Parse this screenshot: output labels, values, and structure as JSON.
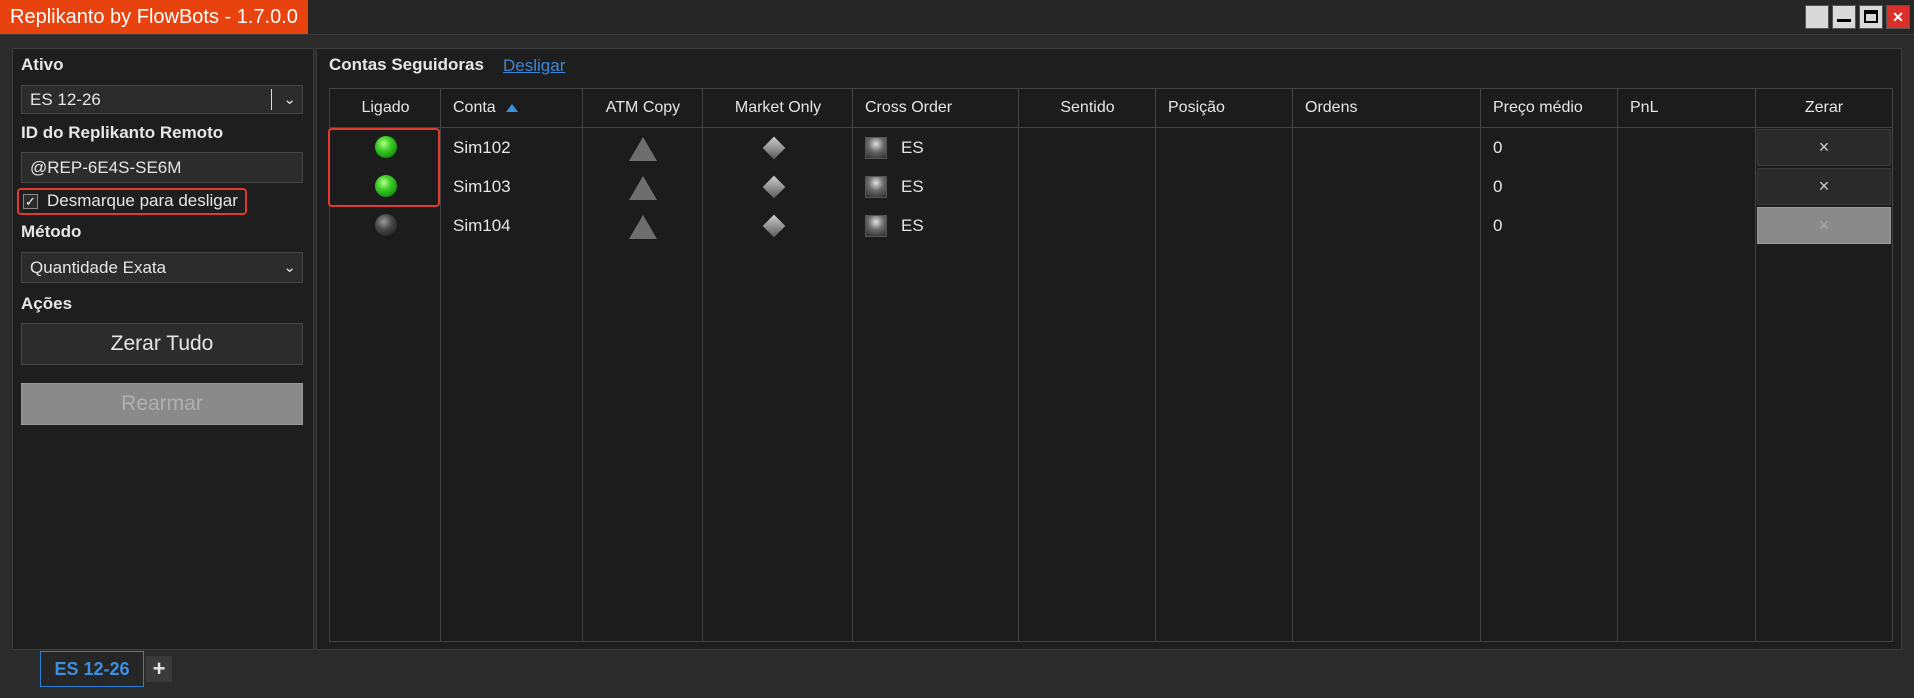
{
  "window": {
    "title": "Replikanto by FlowBots - 1.7.0.0",
    "buttons": [
      "blank",
      "minimize",
      "maximize",
      "close"
    ],
    "accent_color": "#e8430e"
  },
  "left": {
    "ativo_label": "Ativo",
    "ativo_value": "ES 12-26",
    "remote_id_label": "ID do Replikanto Remoto",
    "remote_id_value": "@REP-6E4S-SE6M",
    "checkbox_label": "Desmarque para desligar",
    "checkbox_checked": true,
    "metodo_label": "Método",
    "metodo_value": "Quantidade Exata",
    "acoes_label": "Ações",
    "zerar_tudo_label": "Zerar Tudo",
    "rearmar_label": "Rearmar"
  },
  "right": {
    "section_title": "Contas Seguidoras",
    "desligar_link": "Desligar",
    "columns": [
      "Ligado",
      "Conta",
      "ATM Copy",
      "Market Only",
      "Cross Order",
      "Sentido",
      "Posição",
      "Ordens",
      "Preço médio",
      "PnL",
      "Zerar"
    ],
    "rows": [
      {
        "ligado": "on",
        "conta": "Sim102",
        "atm_icon": "triangle-icon",
        "market_icon": "diamond-icon",
        "cross_order": "ES",
        "sentido": "",
        "posicao": "",
        "ordens": "",
        "preco_medio": "0",
        "pnl": "",
        "zerar": "×",
        "zerar_enabled": true
      },
      {
        "ligado": "on",
        "conta": "Sim103",
        "atm_icon": "triangle-icon",
        "market_icon": "diamond-icon",
        "cross_order": "ES",
        "sentido": "",
        "posicao": "",
        "ordens": "",
        "preco_medio": "0",
        "pnl": "",
        "zerar": "×",
        "zerar_enabled": true
      },
      {
        "ligado": "off",
        "conta": "Sim104",
        "atm_icon": "triangle-icon",
        "market_icon": "diamond-icon",
        "cross_order": "ES",
        "sentido": "",
        "posicao": "",
        "ordens": "",
        "preco_medio": "0",
        "pnl": "",
        "zerar": "×",
        "zerar_enabled": false
      }
    ]
  },
  "tabs": {
    "active": "ES 12-26",
    "add": "+"
  }
}
